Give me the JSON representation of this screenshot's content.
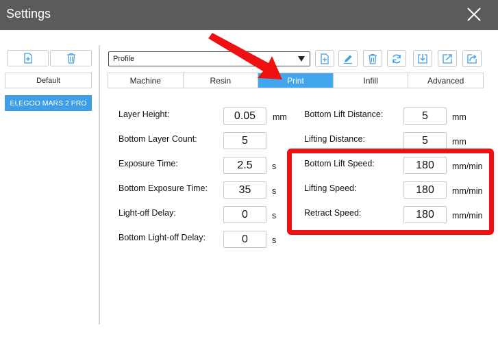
{
  "window": {
    "title": "Settings"
  },
  "sidebar": {
    "items": [
      {
        "label": "Default"
      },
      {
        "label": "ELEGOO MARS 2 PRO"
      }
    ]
  },
  "toolbar": {
    "profile_value": "Profile"
  },
  "tabs": [
    {
      "label": "Machine"
    },
    {
      "label": "Resin"
    },
    {
      "label": "Print"
    },
    {
      "label": "Infill"
    },
    {
      "label": "Advanced"
    }
  ],
  "active_tab": "Print",
  "left_fields": [
    {
      "label": "Layer Height:",
      "value": "0.05",
      "unit": "mm"
    },
    {
      "label": "Bottom Layer Count:",
      "value": "5",
      "unit": ""
    },
    {
      "label": "Exposure Time:",
      "value": "2.5",
      "unit": "s"
    },
    {
      "label": "Bottom Exposure Time:",
      "value": "35",
      "unit": "s"
    },
    {
      "label": "Light-off Delay:",
      "value": "0",
      "unit": "s"
    },
    {
      "label": "Bottom Light-off Delay:",
      "value": "0",
      "unit": "s"
    }
  ],
  "right_fields": [
    {
      "label": "Bottom Lift Distance:",
      "value": "5",
      "unit": "mm"
    },
    {
      "label": "Lifting Distance:",
      "value": "5",
      "unit": "mm"
    },
    {
      "label": "Bottom Lift Speed:",
      "value": "180",
      "unit": "mm/min"
    },
    {
      "label": "Lifting Speed:",
      "value": "180",
      "unit": "mm/min"
    },
    {
      "label": "Retract Speed:",
      "value": "180",
      "unit": "mm/min"
    }
  ],
  "colors": {
    "titlebar": "#5b5b5b",
    "accent_blue": "#42a6ef",
    "annotation_red": "#ef1111"
  },
  "icons": {
    "sidebar": [
      "add-file-icon",
      "trash-icon"
    ],
    "toolbar": [
      "add-file-icon",
      "pencil-icon",
      "trash-icon",
      "refresh-icon",
      "import-icon",
      "export-icon",
      "share-icon"
    ]
  }
}
